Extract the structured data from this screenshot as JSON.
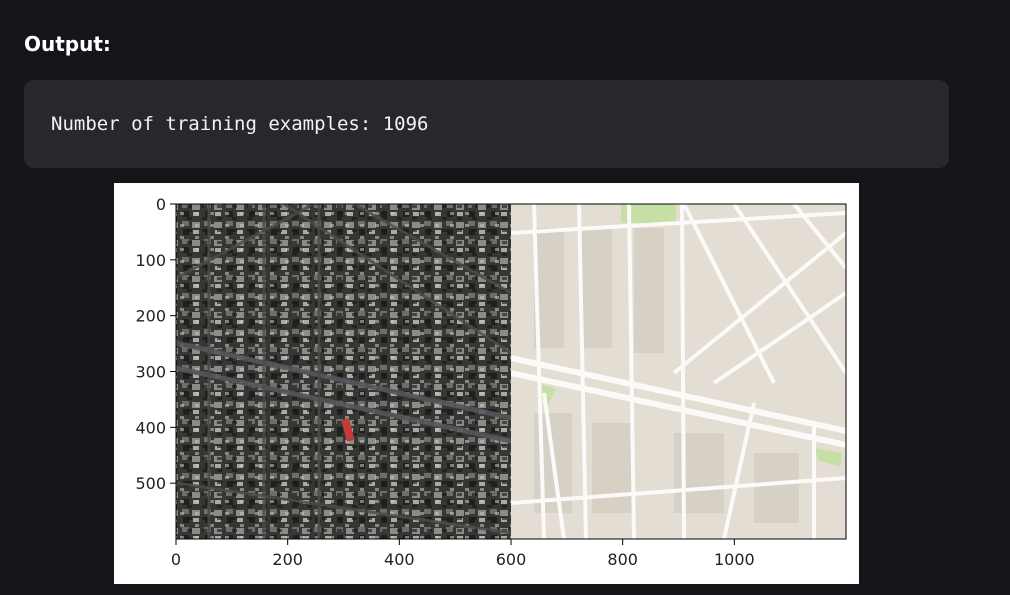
{
  "heading": "Output:",
  "output": {
    "text": "Number of training examples: 1096"
  },
  "figure": {
    "left_panel": "satellite-image",
    "right_panel": "map-image"
  },
  "chart_data": {
    "type": "image",
    "xlim": [
      0,
      1200
    ],
    "ylim": [
      600,
      0
    ],
    "x_ticks": [
      0,
      200,
      400,
      600,
      800,
      1000
    ],
    "y_ticks": [
      0,
      100,
      200,
      300,
      400,
      500
    ],
    "grid": false
  },
  "colors": {
    "page_bg": "#141518",
    "output_bg": "#27282c",
    "map_bg": "#e3ddd3",
    "map_road": "#fbfaf8",
    "map_park": "#c5dfa4",
    "satellite_dark": "#2e302d"
  }
}
